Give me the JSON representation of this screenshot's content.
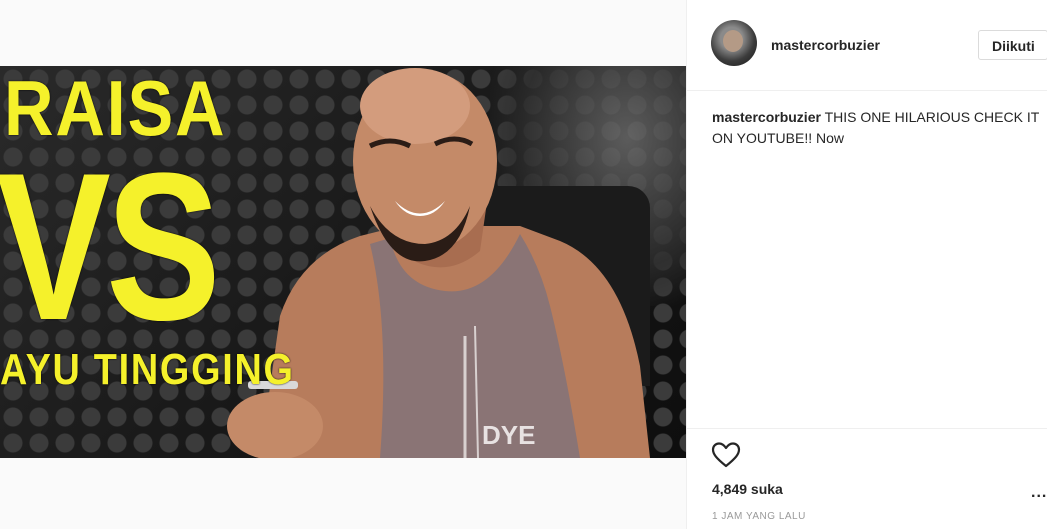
{
  "post": {
    "image_overlay": {
      "line1": "RAISA",
      "line2": "VS",
      "line3": "AYU TINGGING"
    },
    "shirt_logo": "DYE"
  },
  "header": {
    "username": "mastercorbuzier",
    "follow_label": "Diikuti"
  },
  "caption": {
    "username": "mastercorbuzier",
    "text": " THIS ONE HILARIOUS CHECK IT ON YOUTUBE!! Now"
  },
  "actions": {
    "like_icon": "heart-outline-icon",
    "more_icon": "ellipsis-icon",
    "more_label": "..."
  },
  "stats": {
    "likes": "4,849 suka",
    "timestamp": "1 JAM YANG LALU"
  },
  "colors": {
    "accent_yellow": "#f5f12b",
    "border": "#efefef",
    "text": "#262626",
    "muted": "#999999"
  }
}
